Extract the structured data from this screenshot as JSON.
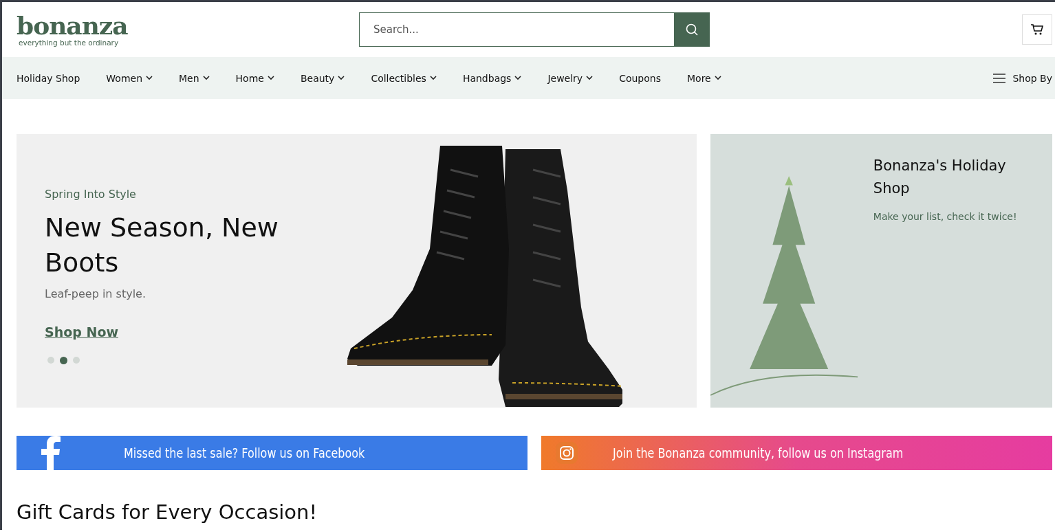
{
  "header": {
    "logo": "bonanza",
    "tagline": "everything but the ordinary",
    "search": {
      "placeholder": "Search..."
    }
  },
  "nav": {
    "items": [
      {
        "label": "Holiday Shop",
        "kind": "link"
      },
      {
        "label": "Women",
        "kind": "dropdown"
      },
      {
        "label": "Men",
        "kind": "dropdown"
      },
      {
        "label": "Home",
        "kind": "dropdown"
      },
      {
        "label": "Beauty",
        "kind": "dropdown"
      },
      {
        "label": "Collectibles",
        "kind": "dropdown"
      },
      {
        "label": "Handbags",
        "kind": "dropdown"
      },
      {
        "label": "Jewelry",
        "kind": "dropdown"
      },
      {
        "label": "Coupons",
        "kind": "link"
      },
      {
        "label": "More",
        "kind": "dropdown"
      }
    ],
    "shop_by": "Shop By"
  },
  "hero": {
    "eyebrow": "Spring Into Style",
    "title": "New Season, New Boots",
    "subtitle": "Leaf-peep in style.",
    "link": "Shop Now",
    "dots": [
      {
        "selected": false
      },
      {
        "selected": true
      },
      {
        "selected": false
      }
    ]
  },
  "promo": {
    "title": "Bonanza's Holiday Shop",
    "text": "Make your list, check it twice!"
  },
  "social_banners": [
    {
      "kind": "facebook",
      "text": "Missed the last sale? Follow us on Facebook"
    },
    {
      "kind": "instagram",
      "text": "Join the Bonanza community, follow us on Instagram"
    }
  ],
  "section_heading": "Gift Cards for Every Occasion!"
}
